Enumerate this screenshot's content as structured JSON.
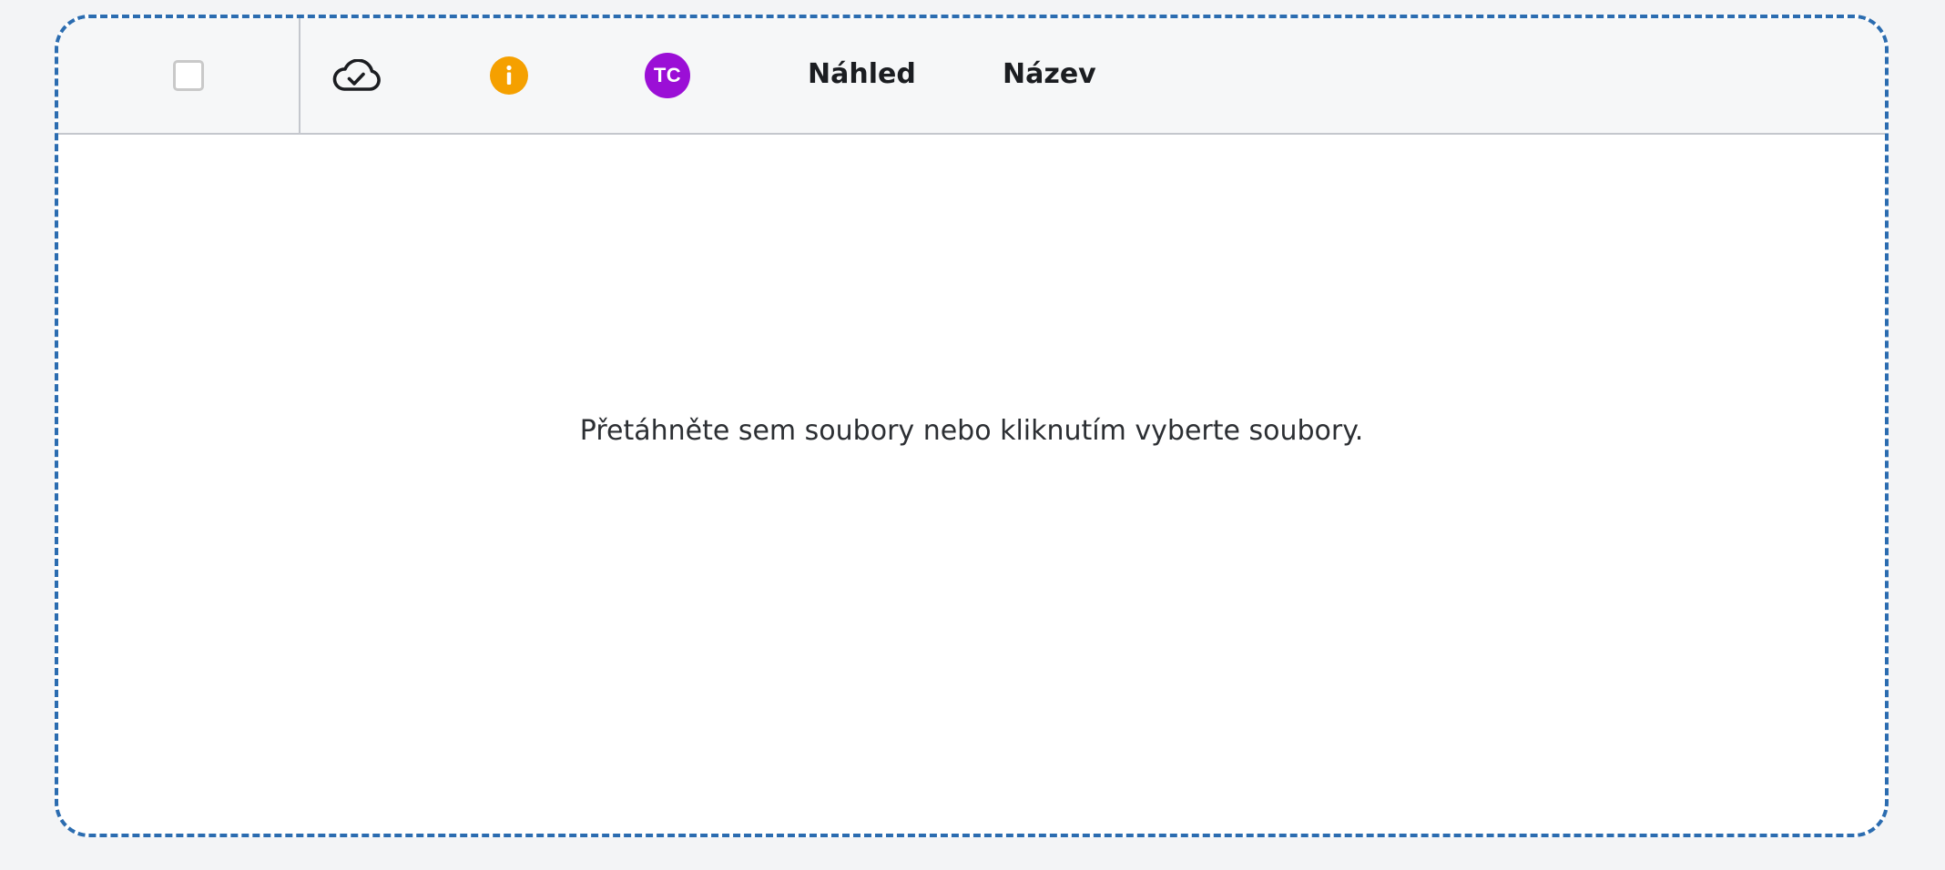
{
  "table": {
    "select_all": {
      "checked": false
    },
    "columns": {
      "sync_icon": "cloud-check-icon",
      "info_icon": "info-icon",
      "avatar_initials": "TC",
      "preview_label": "Náhled",
      "name_label": "Název"
    },
    "empty_message": "Přetáhněte sem soubory nebo kliknutím vyberte soubory."
  },
  "colors": {
    "dropzone_border": "#2b6cb0",
    "info_badge": "#f5a000",
    "avatar": "#9b0fd6"
  }
}
